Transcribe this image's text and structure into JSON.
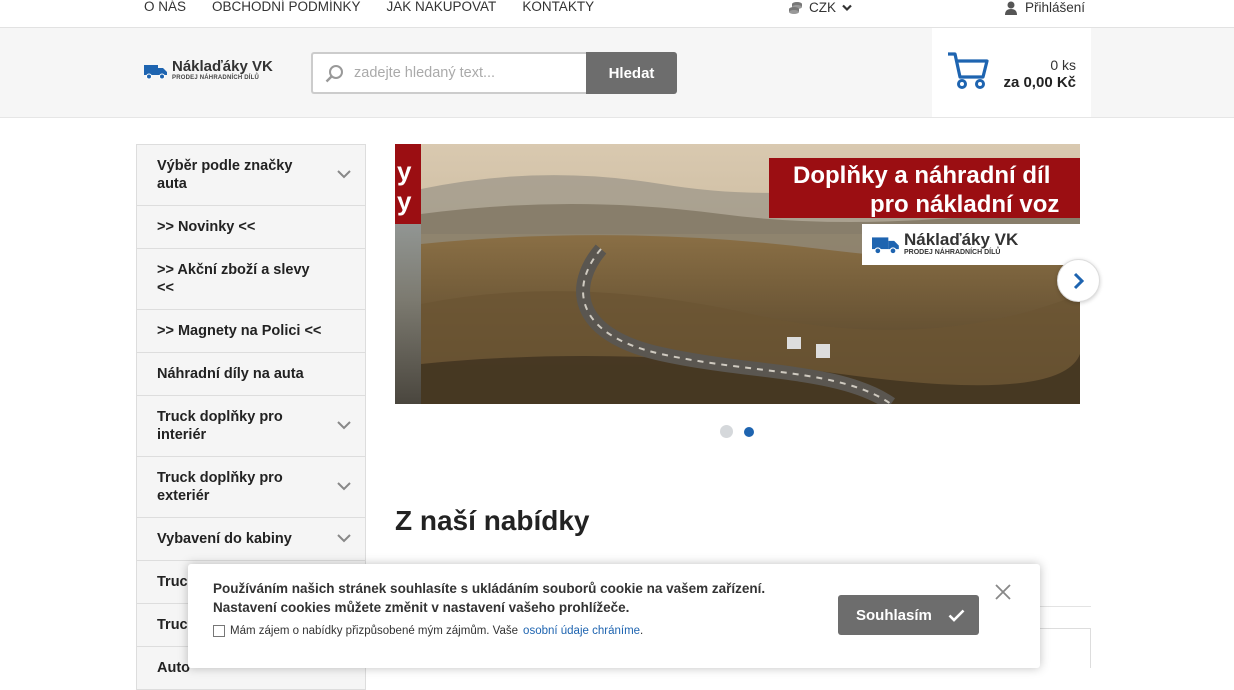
{
  "topnav": {
    "items": [
      "O NÁS",
      "OBCHODNÍ PODMÍNKY",
      "JAK NAKUPOVAT",
      "KONTAKTY"
    ],
    "currency": "CZK",
    "login": "Přihlášení"
  },
  "header": {
    "logo_title": "Náklaďáky VK",
    "logo_subtitle": "PRODEJ NÁHRADNÍCH DÍLŮ",
    "search_placeholder": "zadejte hledaný text...",
    "search_button": "Hledat",
    "cart_qty": "0 ks",
    "cart_price": "za 0,00 Kč"
  },
  "sidebar": {
    "items": [
      {
        "label": "Výběr podle značky auta",
        "chevron": true
      },
      {
        "label": ">> Novinky <<",
        "chevron": false
      },
      {
        "label": ">> Akční zboží a slevy <<",
        "chevron": false
      },
      {
        "label": ">> Magnety na Polici <<",
        "chevron": false
      },
      {
        "label": "Náhradní díly na auta",
        "chevron": false
      },
      {
        "label": "Truck doplňky pro interiér",
        "chevron": true
      },
      {
        "label": "Truck doplňky pro exteriér",
        "chevron": true
      },
      {
        "label": "Vybavení do kabiny",
        "chevron": true
      },
      {
        "label": "Truck oblečení, doplňky",
        "chevron": false
      },
      {
        "label": "Truck",
        "chevron": false
      },
      {
        "label": "Auto",
        "chevron": false
      }
    ]
  },
  "banner": {
    "prev_text": [
      "y",
      "y"
    ],
    "headline_line1": "Doplňky a náhradní díl",
    "headline_line2": "pro nákladní voz",
    "logo_title": "Náklaďáky VK",
    "logo_subtitle": "PRODEJ NÁHRADNÍCH DÍLŮ",
    "slide_count": 2,
    "active_slide": 2
  },
  "main": {
    "section_title": "Z naší nabídky"
  },
  "cookie": {
    "line1": "Používáním našich stránek souhlasíte s ukládáním souborů cookie na vašem zařízení.",
    "line2": "Nastavení cookies můžete změnit v nastavení vašeho prohlížeče.",
    "consent_text": "Mám zájem o nabídky přizpůsobené mým zájmům. Vaše",
    "consent_link": "osobní údaje chráníme",
    "consent_end": ".",
    "accept_button": "Souhlasím"
  },
  "colors": {
    "accent_blue": "#1e64b0",
    "banner_red": "#9b0e12",
    "button_gray": "#6d6d6d"
  }
}
